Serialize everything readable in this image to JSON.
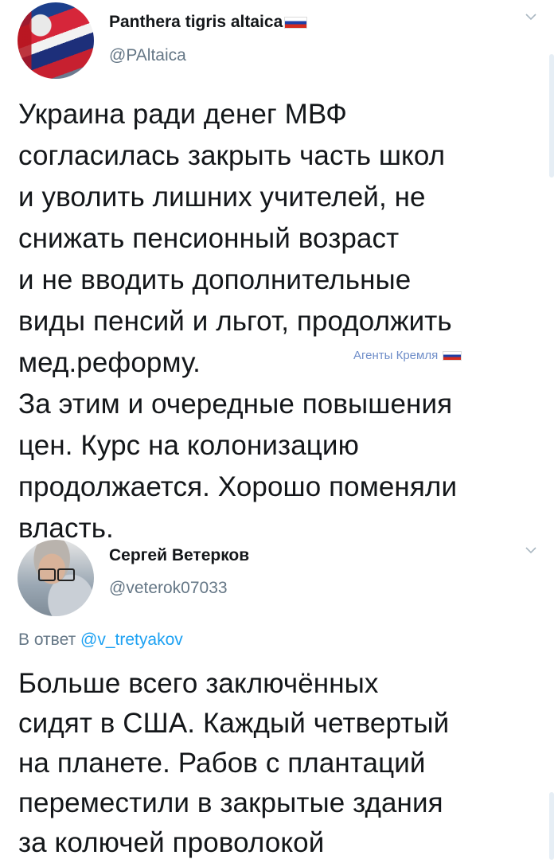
{
  "tweets": [
    {
      "name": "Panthera tigris altaica",
      "handle": "@PAltaica",
      "text": "Украина ради денег МВФ\nсогласилась закрыть часть школ\nи уволить лишних учителей, не\nснижать пенсионный возраст\nи не вводить дополнительные\nвиды пенсий и льгот, продолжить\nмед.реформу.\nЗа этим и очередные повышения\nцен. Курс на колонизацию\nпродолжается. Хорошо поменяли\nвласть."
    },
    {
      "name": "Сергей Ветерков",
      "handle": "@veterok07033",
      "reply_prefix": "В ответ",
      "reply_to": "@v_tretyakov",
      "text": "Больше всего заключённых\nсидят в США. Каждый четвертый\nна планете. Рабов с плантаций\nпереместили в закрытые здания\nза колючей проволокой"
    }
  ],
  "watermark": "Агенты Кремля",
  "icons": {
    "menu": "chevron-down-icon",
    "flag": "russian-flag-icon"
  },
  "colors": {
    "text": "#14171a",
    "secondary": "#657786",
    "link": "#1da1f2"
  }
}
